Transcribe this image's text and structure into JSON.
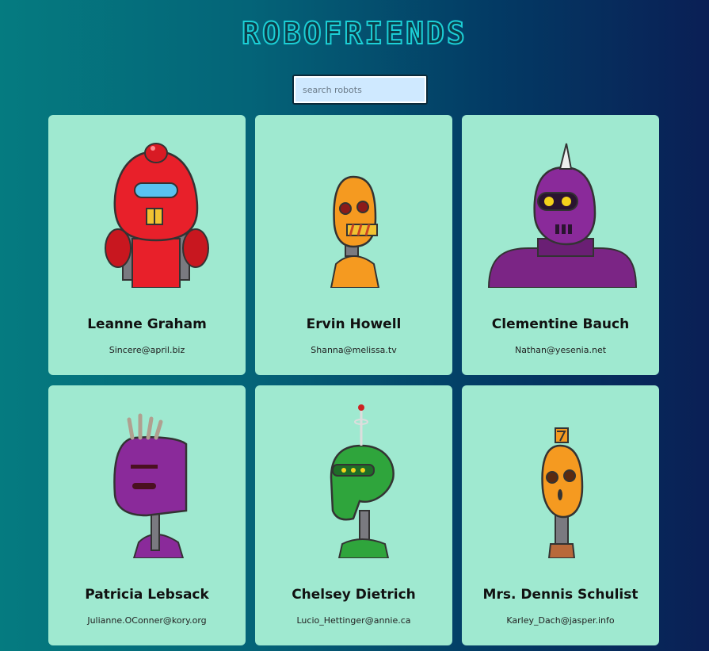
{
  "app": {
    "title": "ROBOFRIENDS"
  },
  "search": {
    "placeholder": "search robots",
    "value": ""
  },
  "robots": [
    {
      "name": "Leanne Graham",
      "email": "Sincere@april.biz",
      "color": "#e8202a"
    },
    {
      "name": "Ervin Howell",
      "email": "Shanna@melissa.tv",
      "color": "#f59a20"
    },
    {
      "name": "Clementine Bauch",
      "email": "Nathan@yesenia.net",
      "color": "#8a2a9a"
    },
    {
      "name": "Patricia Lebsack",
      "email": "Julianne.OConner@kory.org",
      "color": "#8a2a9a"
    },
    {
      "name": "Chelsey Dietrich",
      "email": "Lucio_Hettinger@annie.ca",
      "color": "#2fa53c"
    },
    {
      "name": "Mrs. Dennis Schulist",
      "email": "Karley_Dach@jasper.info",
      "color": "#f59a20"
    }
  ]
}
